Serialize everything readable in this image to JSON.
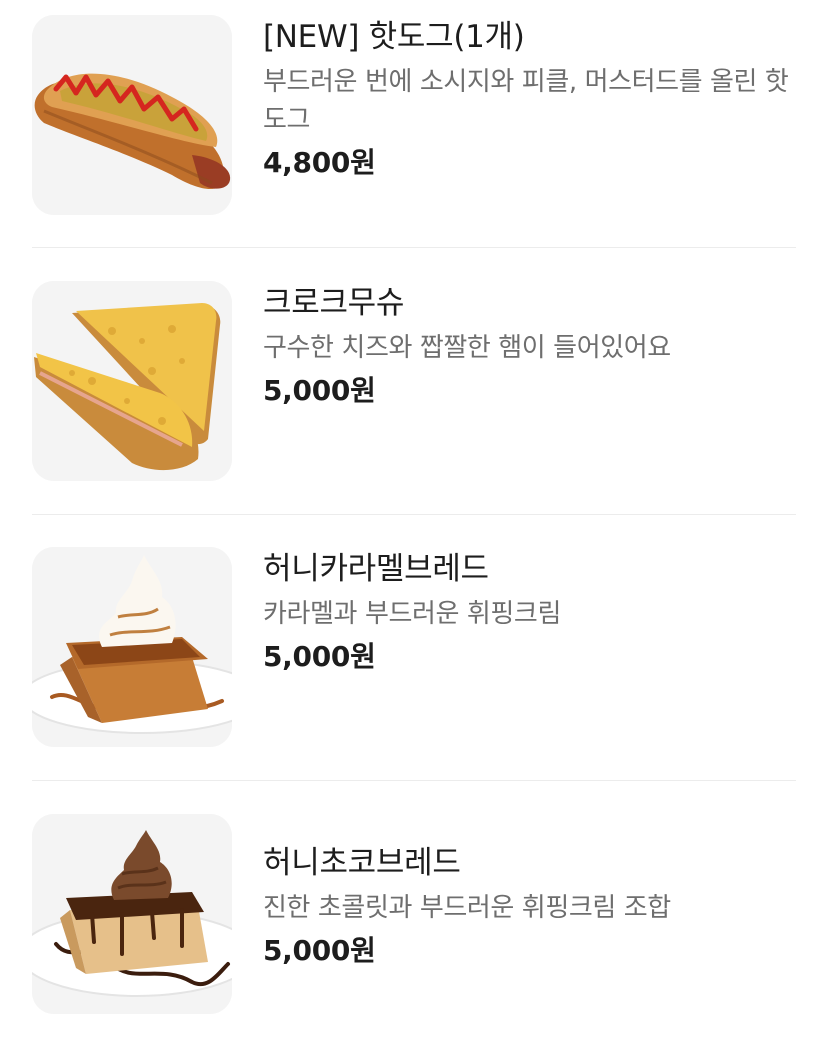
{
  "menu": {
    "items": [
      {
        "name": "[NEW] 핫도그(1개)",
        "description": "부드러운 번에 소시지와 피클, 머스터드를 올린 핫도그",
        "price": "4,800원",
        "image_icon": "hotdog-image"
      },
      {
        "name": "크로크무슈",
        "description": "구수한 치즈와 짭짤한 햄이 들어있어요",
        "price": "5,000원",
        "image_icon": "croque-monsieur-image"
      },
      {
        "name": "허니카라멜브레드",
        "description": "카라멜과 부드러운 휘핑크림",
        "price": "5,000원",
        "image_icon": "honey-caramel-bread-image"
      },
      {
        "name": "허니초코브레드",
        "description": "진한 초콜릿과 부드러운 휘핑크림 조합",
        "price": "5,000원",
        "image_icon": "honey-choco-bread-image"
      }
    ]
  }
}
